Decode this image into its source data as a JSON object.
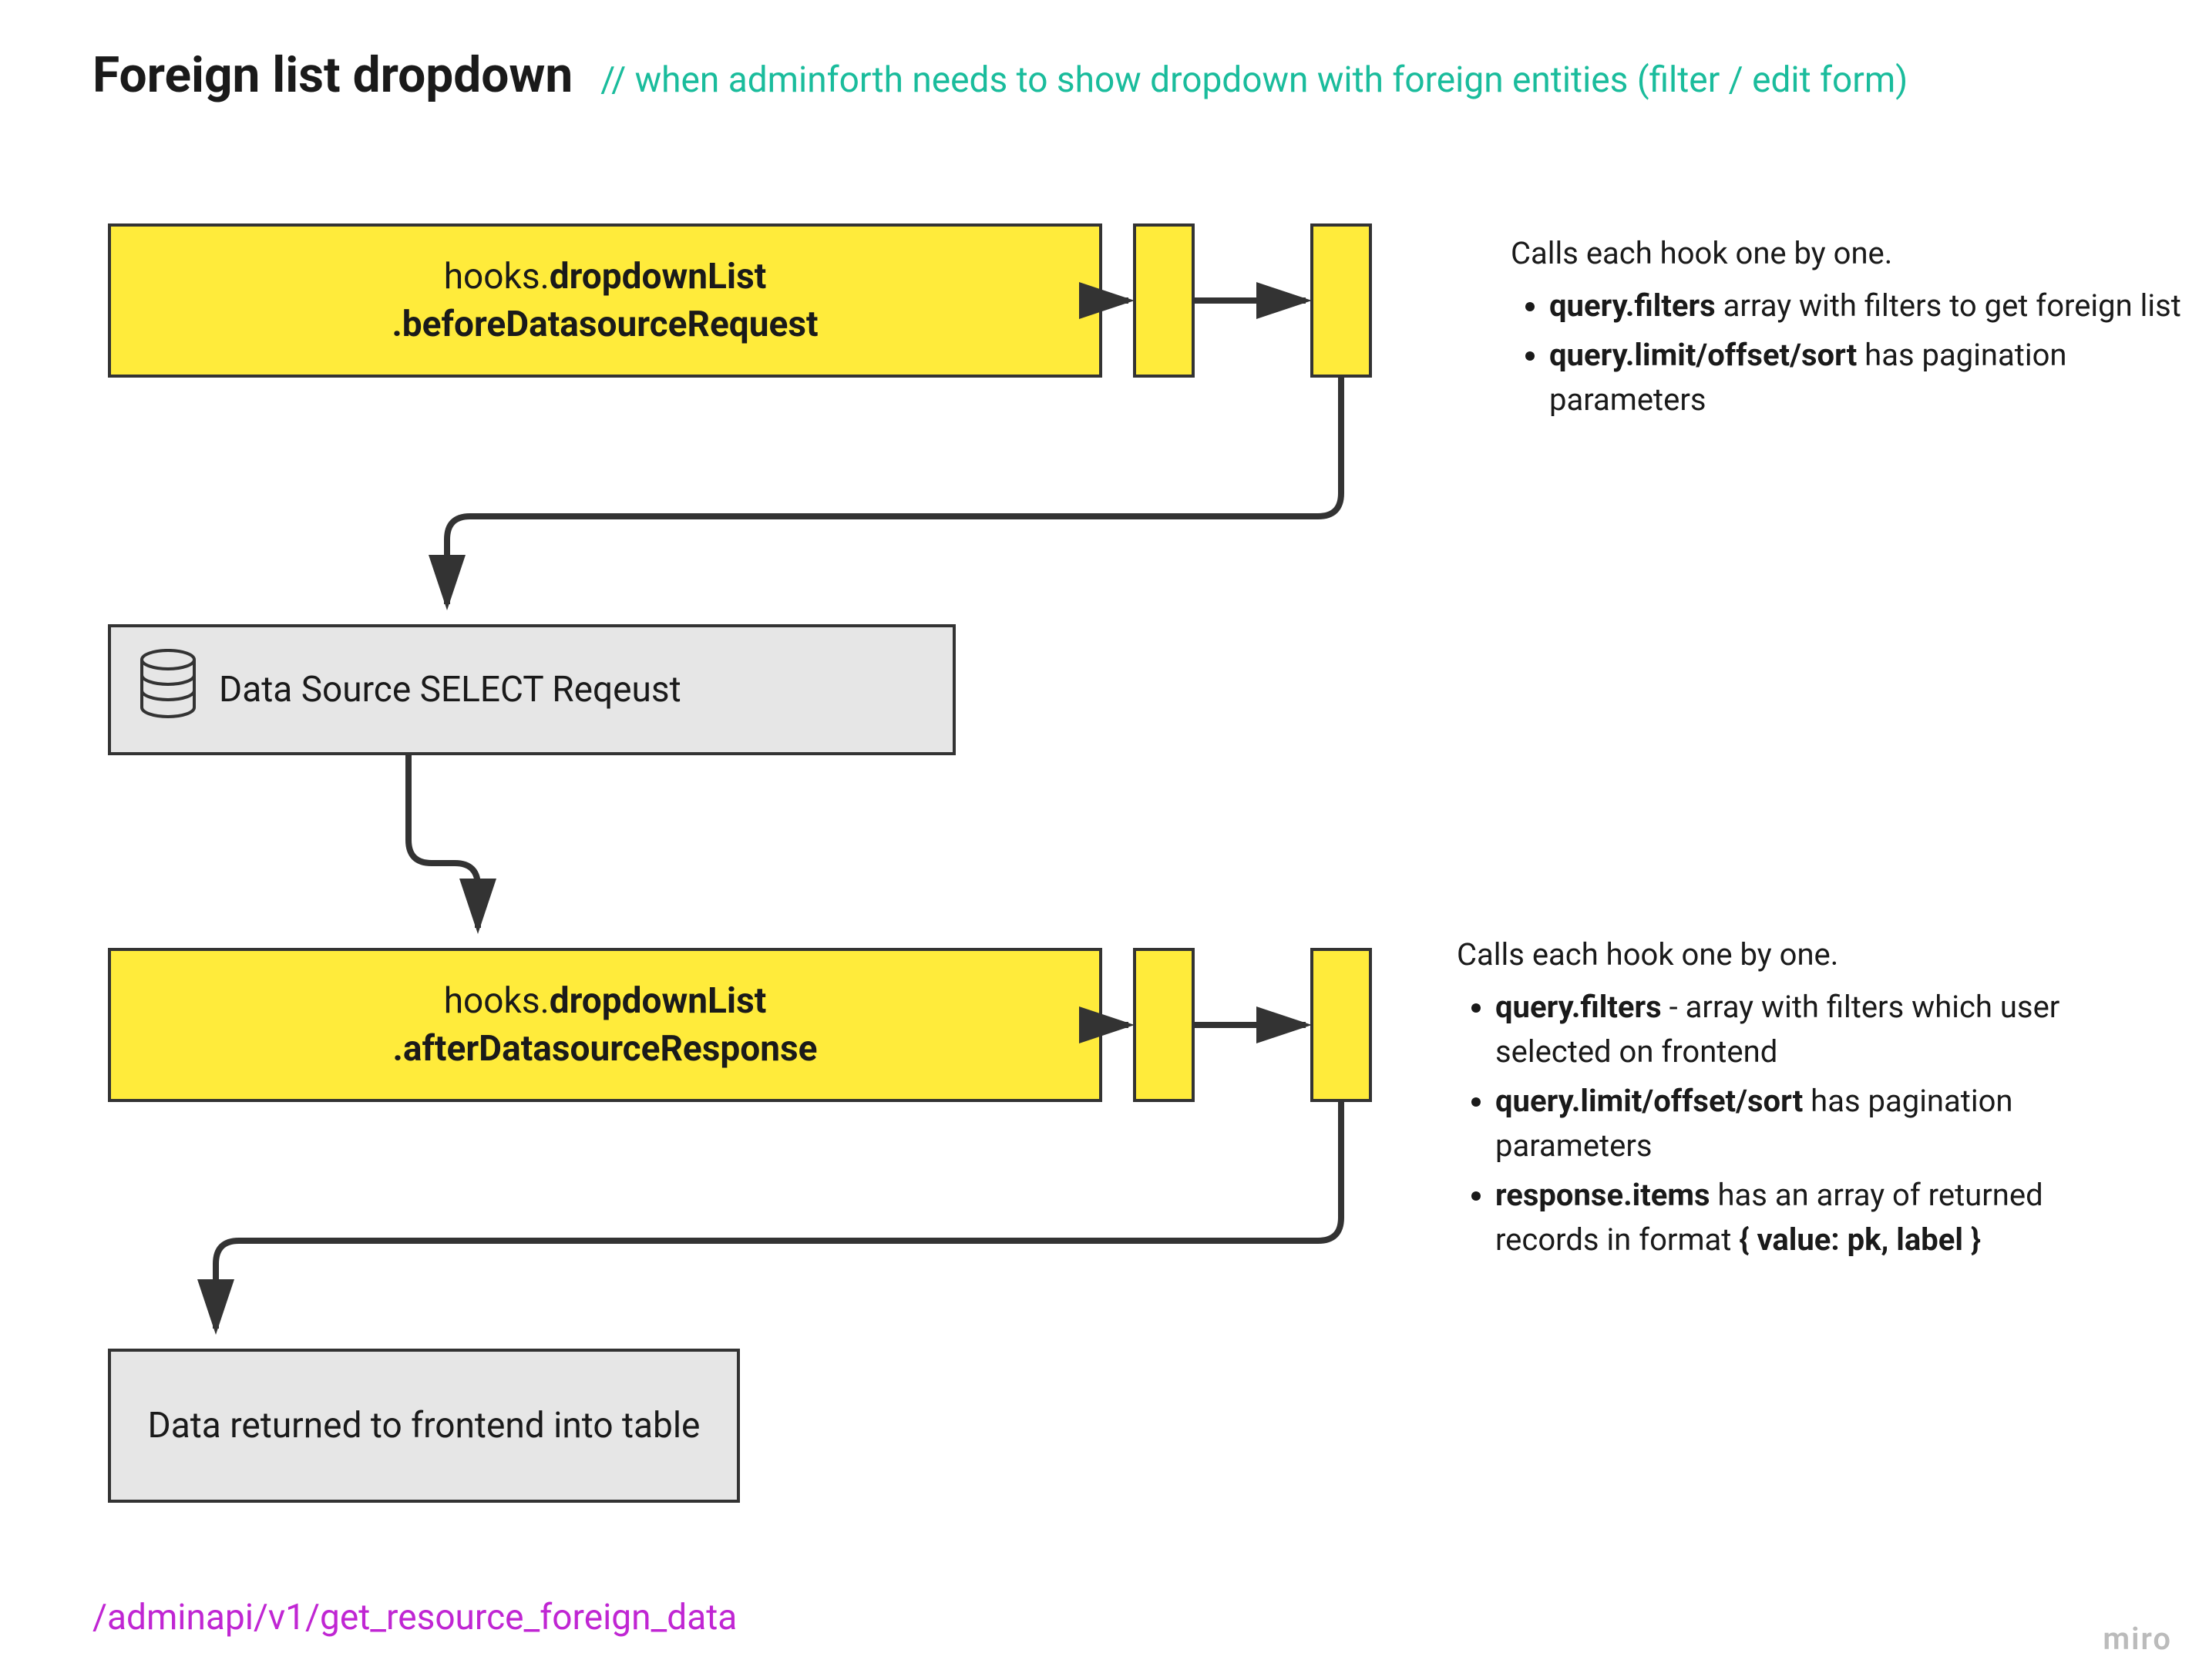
{
  "header": {
    "title": "Foreign list dropdown",
    "subtitle": "// when adminforth needs to show dropdown with foreign entities (filter / edit form)"
  },
  "boxes": {
    "hook_before": {
      "prefix": "hooks.",
      "bold1": "dropdownList",
      "line2": ".beforeDatasourceRequest"
    },
    "datasource": {
      "label": "Data Source SELECT Reqeust"
    },
    "hook_after": {
      "prefix": "hooks.",
      "bold1": "dropdownList",
      "line2": ".afterDatasourceResponse"
    },
    "result": {
      "label": "Data returned to frontend into table"
    }
  },
  "annotations": {
    "top": {
      "intro": "Calls each hook one by one.",
      "items": [
        {
          "bold": "query.filters",
          "rest": " array with filters to get foreign list"
        },
        {
          "bold": "query.limit/offset/sort",
          "rest": " has pagination parameters"
        }
      ]
    },
    "bottom": {
      "intro": "Calls each hook one by one.",
      "items": [
        {
          "bold": "query.filters",
          "rest": " - array with filters which user selected on frontend"
        },
        {
          "bold": "query.limit/offset/sort",
          "rest": " has pagination parameters"
        },
        {
          "bold": "response.items",
          "rest": " has an array of returned records in format ",
          "bold2": "{ value: pk, label }"
        }
      ]
    }
  },
  "endpoint": "/adminapi/v1/get_resource_foreign_data",
  "logo": "miro"
}
